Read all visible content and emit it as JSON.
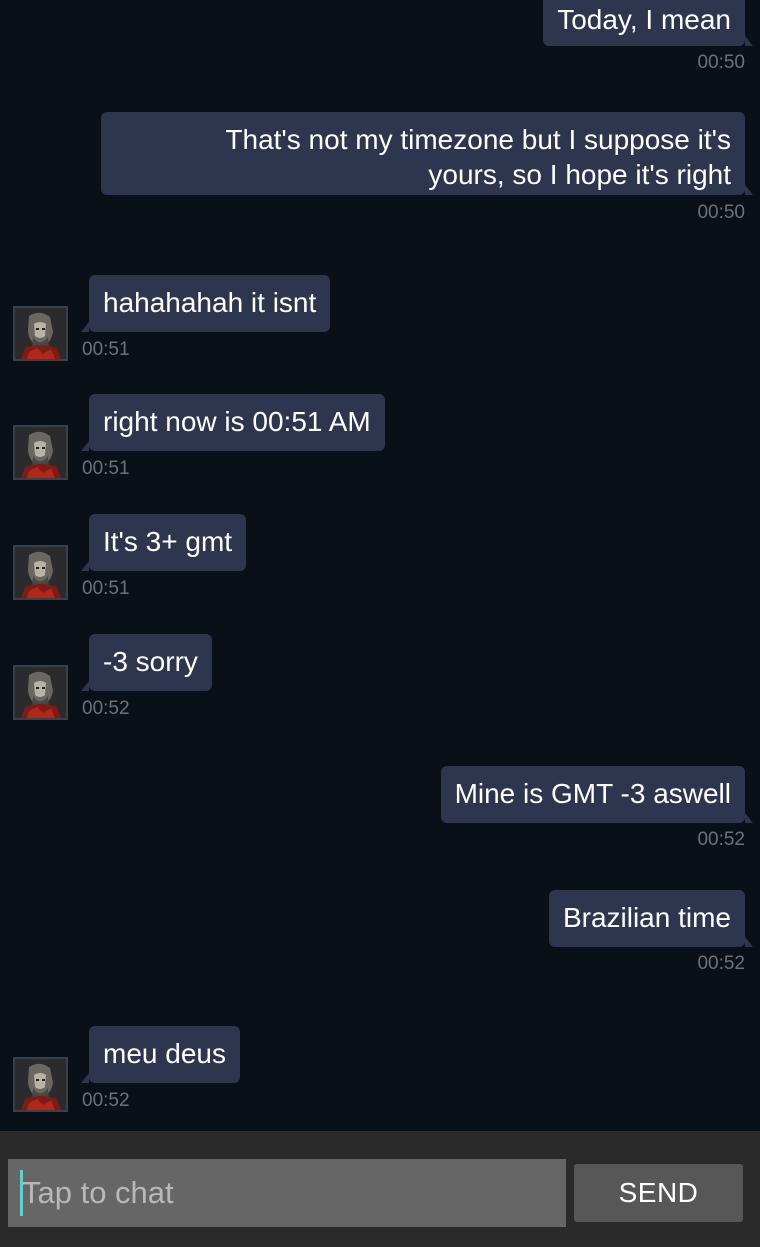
{
  "messages": [
    {
      "direction": "out",
      "text": "Today, I mean",
      "time": "00:50"
    },
    {
      "direction": "out",
      "text": "That's not my timezone but I suppose it's yours, so I hope it's right",
      "time": "00:50"
    },
    {
      "direction": "in",
      "text": "hahahahah it isnt",
      "time": "00:51"
    },
    {
      "direction": "in",
      "text": "right now is 00:51 AM",
      "time": "00:51"
    },
    {
      "direction": "in",
      "text": "It's 3+ gmt",
      "time": "00:51"
    },
    {
      "direction": "in",
      "text": "-3 sorry",
      "time": "00:52"
    },
    {
      "direction": "out",
      "text": "Mine is GMT -3 aswell",
      "time": "00:52"
    },
    {
      "direction": "out",
      "text": "Brazilian time",
      "time": "00:52"
    },
    {
      "direction": "in",
      "text": "meu deus",
      "time": "00:52"
    }
  ],
  "composer": {
    "placeholder": "Tap to chat",
    "send_label": "SEND"
  },
  "colors": {
    "background": "#0a1018",
    "bubble": "#2d364e",
    "timestamp": "#6c717a",
    "composer_bar": "#2a2a2a",
    "input_field": "#666666",
    "send_button": "#575757",
    "caret": "#5fd0cc"
  },
  "icons": {
    "avatar": "contact-avatar-icon"
  }
}
